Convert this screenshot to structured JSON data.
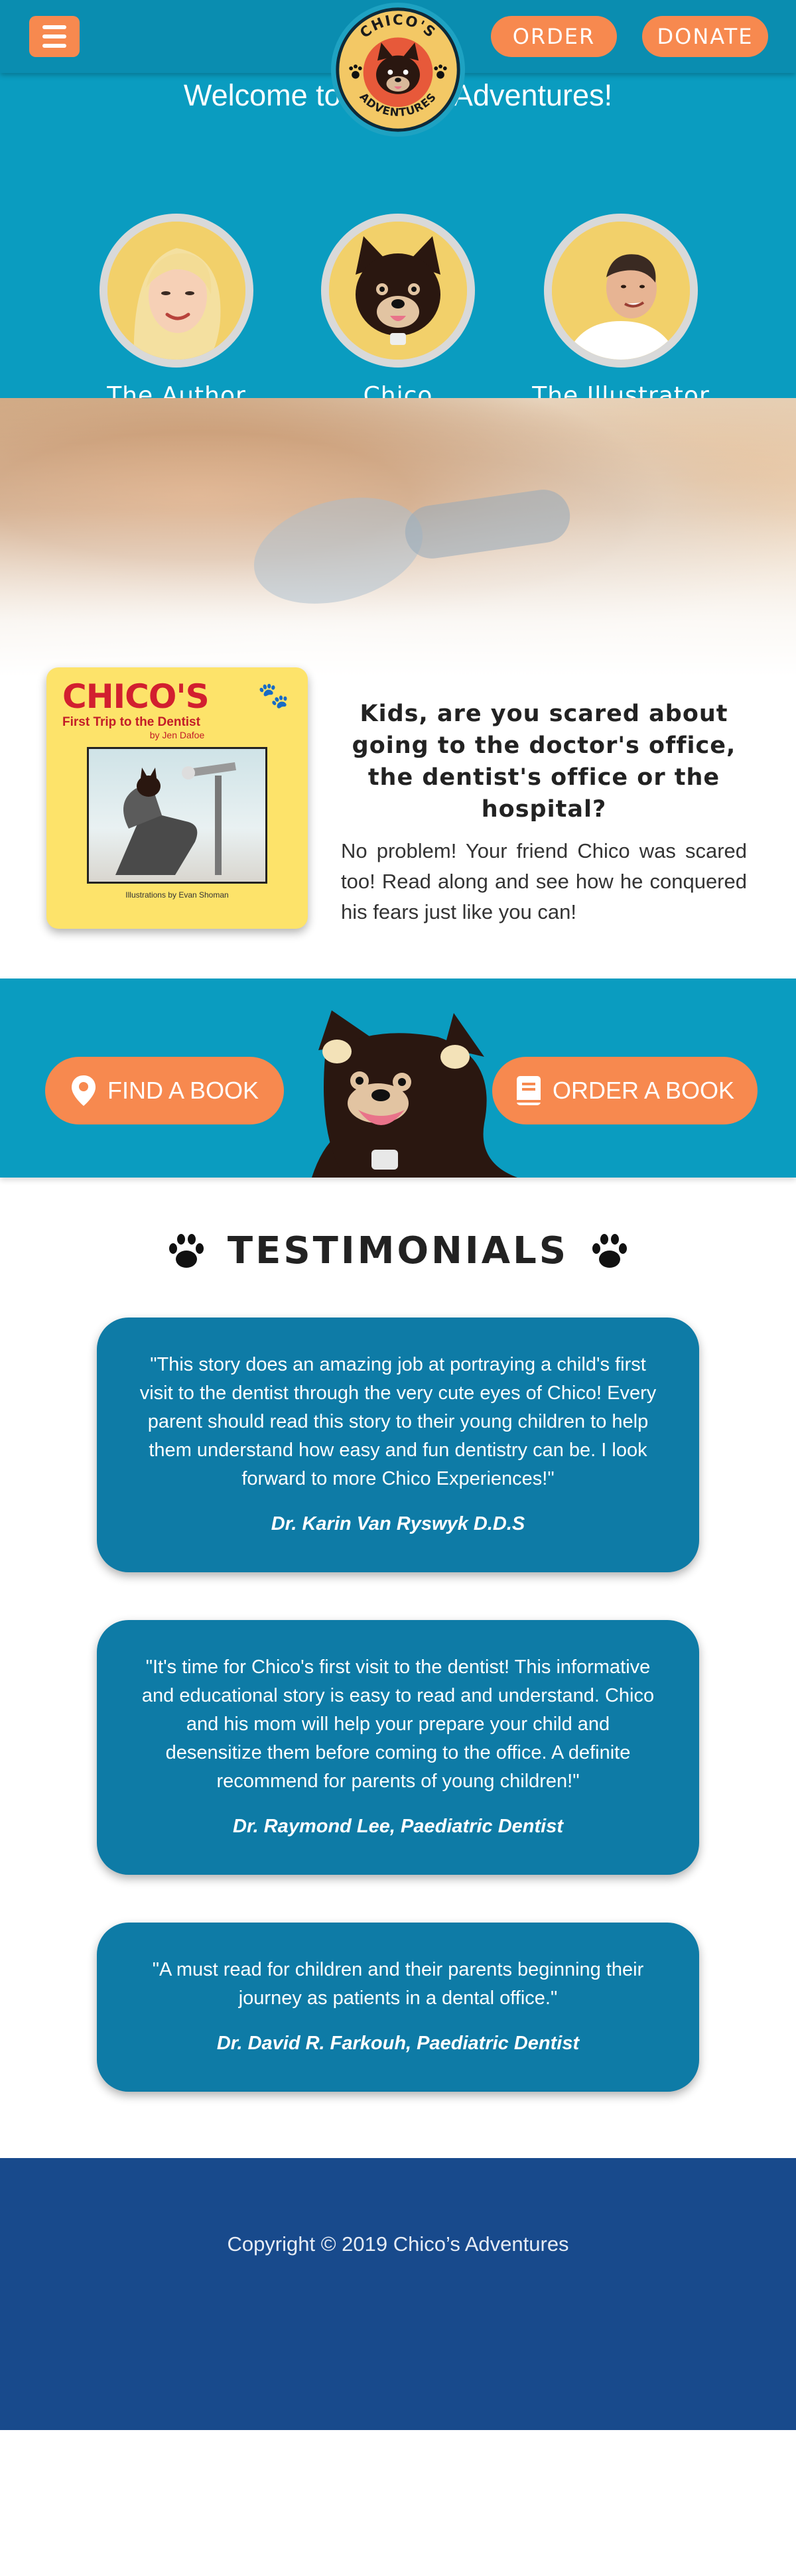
{
  "header": {
    "menu_icon": "hamburger-icon",
    "logo_text_top": "CHICO'S",
    "logo_text_bottom": "ADVENTURES",
    "order_label": "ORDER",
    "donate_label": "DONATE"
  },
  "hero": {
    "welcome": "Welcome to Chico’s Adventures!",
    "people": [
      {
        "label": "The Author"
      },
      {
        "label": "Chico"
      },
      {
        "label": "The Illustrator"
      }
    ]
  },
  "book": {
    "cover_title": "CHICO'S",
    "cover_subtitle": "First Trip to the Dentist",
    "cover_author": "by Jen Dafoe",
    "cover_illustrator": "Illustrations by Evan Shoman",
    "headline": "Kids, are you scared about going to the doctor's office, the dentist's office or the hospital?",
    "body": "No problem! Your friend Chico was scared too! Read along and see how he conquered his fears just like you can!"
  },
  "cta": {
    "find_label": "FIND A BOOK",
    "find_icon": "map-pin-icon",
    "order_label": "ORDER A BOOK",
    "order_icon": "book-icon"
  },
  "testimonials": {
    "heading": "TESTIMONIALS",
    "items": [
      {
        "quote": "\"This story does an amazing job at portraying a child's first visit to the dentist through the very cute eyes of Chico! Every parent should read this story to their young children to help them understand how easy and fun dentistry can be. I look forward to more Chico Experiences!\"",
        "author": "Dr. Karin Van Ryswyk D.D.S"
      },
      {
        "quote": "\"It's time for Chico's first visit to the dentist! This informative and educational story is easy to read and understand. Chico and his mom will help your prepare your child and desensitize them before coming to the office. A definite recommend for parents of young children!\"",
        "author": "Dr. Raymond Lee, Paediatric Dentist"
      },
      {
        "quote": "\"A must read for children and their parents beginning their journey as patients in a dental office.\"",
        "author": "Dr. David R. Farkouh, Paediatric Dentist"
      }
    ]
  },
  "footer": {
    "copyright": "Copyright © 2019 Chico’s Adventures"
  },
  "colors": {
    "header_bg": "#0a8db0",
    "hero_bg": "#0a9cc0",
    "accent_orange": "#f7894f",
    "card_blue": "#0e7ba6",
    "footer_bg": "#184a8c"
  }
}
